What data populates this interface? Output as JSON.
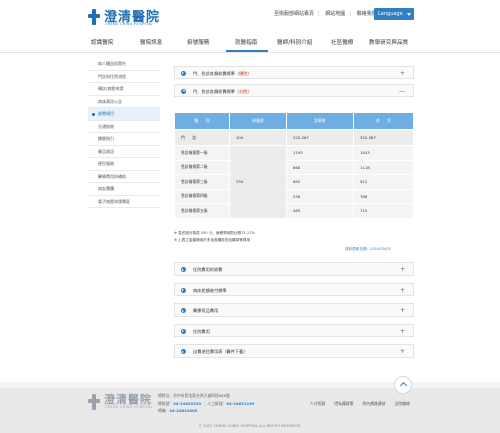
{
  "header": {
    "logo_name": "澄清醫院",
    "logo_en": "CHENG CHING HOSPITAL",
    "links": [
      "至衛服部網站專頁",
      "網站地圖",
      "聯絡我們"
    ],
    "language_label": "Language"
  },
  "nav": {
    "items": [
      "認識醫院",
      "醫院訊息",
      "掛號服務",
      "就醫指南",
      "醫師/科別介紹",
      "社區醫療",
      "教學研究與品質"
    ],
    "active": "就醫指南"
  },
  "sidebar": {
    "items": [
      "病人權益與責任",
      "門診與住院流程",
      "轉診/病歷申請",
      "病床資訊公告",
      "收費項目",
      "交通指南",
      "樓層指引",
      "藥品資訊",
      "便民服務",
      "醫療費用與補助",
      "病友團體",
      "電子病歷申請專區"
    ],
    "active_index": 4
  },
  "main": {
    "accordion_top": [
      {
        "prefix": "門、急診各類收費標準",
        "highlight": "（總院）",
        "sign": "+"
      },
      {
        "prefix": "門、急診各類收費標準",
        "highlight": "（分院）",
        "sign": "—"
      }
    ],
    "table": {
      "headers": [
        "類　　別",
        "掛號費",
        "診察費",
        "合　　計"
      ],
      "rows": [
        [
          "門　　診",
          "100",
          "220-267",
          "320-367"
        ],
        [
          "急診檢傷第一級",
          "",
          "1193",
          "1443"
        ],
        [
          "急診檢傷第二級",
          "",
          "868",
          "1118"
        ],
        [
          "急診檢傷第三級",
          "",
          "662",
          "912"
        ],
        [
          "急診檢傷第四級",
          "",
          "536",
          "786"
        ],
        [
          "急診檢傷第五級",
          "",
          "465",
          "715"
        ]
      ],
      "emergency_fee": "250"
    },
    "notes": [
      {
        "text": "※ 急診部分負擔 ",
        "amount": "550 元",
        "rest": "，兩餐費用則比照71.17%"
      },
      {
        "text": "※ 上表之金額適用於未含各種檢查及藥劑等費用",
        "amount": "",
        "rest": ""
      }
    ],
    "updated": "資料更新日期：2014/05/05",
    "accordion_bottom": [
      "住院費用的收費",
      "病床差額收付標準",
      "醫療用品費用",
      "住院費用",
      "自費項目費用表（醫件下載）"
    ]
  },
  "footer": {
    "logo_name": "澄清醫院",
    "logo_en": "CHENG CHING HOSPITAL",
    "address": "總院址：台中市西屯區台灣大道四段966號",
    "phone_label": "總掛號：",
    "phone": "04-24632293",
    "manual_label": "人工掛號：",
    "manual": "04-24631199",
    "fax_label": "總機：",
    "fax": "04-24632000",
    "links": [
      "人才招募",
      "隱私權政策",
      "院內網路連結",
      "全院聯絡"
    ],
    "copyright": "© 2012 CHENG CHING HOSPITAL ALL RIGHTS RESERVED."
  },
  "colors": {
    "brand": "#1e6fb5",
    "table_header": "#6eaee2",
    "highlight_red": "#d0231c"
  }
}
